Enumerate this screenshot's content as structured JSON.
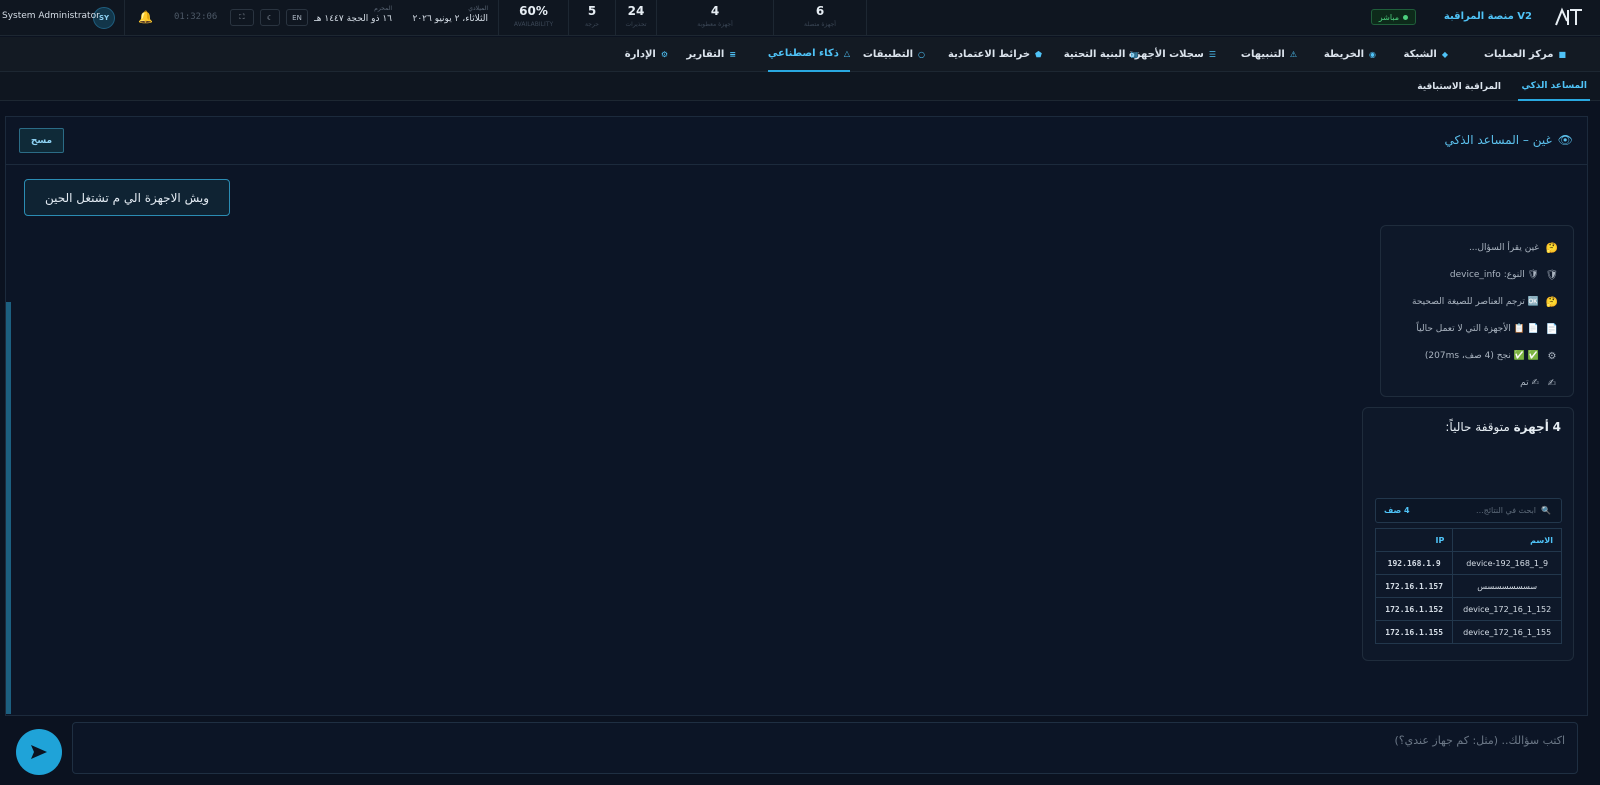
{
  "header": {
    "logo_text": "AM",
    "brand_title": "V2 منصة المراقبة",
    "live_label": "مباشر",
    "stats": [
      {
        "value": "60%",
        "label": "AVAILABILITY"
      },
      {
        "value": "24",
        "label": "تحذيرات"
      },
      {
        "value": "5",
        "label": "حرجة"
      },
      {
        "value": "4",
        "label": "أجهزة معطوبة"
      },
      {
        "value": "6",
        "label": "أجهزة متصلة"
      }
    ],
    "gregorian_label": "الميلادي",
    "gregorian_date": "الثلاثاء، ٢ يونيو ٢٠٢٦",
    "hijri_label": "المحرم",
    "hijri_date": "١٦ ذو الحجة ١٤٤٧ هـ",
    "lang_toggle": "EN",
    "clock": "01:32:06",
    "user_initials": "SY",
    "user_name": "System Administrator"
  },
  "nav": {
    "items": [
      {
        "label": "مركز العمليات",
        "icon": "■"
      },
      {
        "label": "الشبكة",
        "icon": "◆"
      },
      {
        "label": "الخريطة",
        "icon": "◉"
      },
      {
        "label": "التنبيهات",
        "icon": "⚠"
      },
      {
        "label": "سجلات الأجهزة",
        "icon": "☰"
      },
      {
        "label": "البنية التحتية",
        "icon": "▤"
      },
      {
        "label": "خرائط الاعتمادية",
        "icon": "⬟"
      },
      {
        "label": "التطبيقات",
        "icon": "○"
      },
      {
        "label": "ذكاء اصطناعي",
        "icon": "△"
      },
      {
        "label": "التقارير",
        "icon": "≡"
      },
      {
        "label": "الإدارة",
        "icon": "⚙"
      }
    ],
    "active_index": 8
  },
  "subtabs": {
    "items": [
      "المساعد الذكي",
      "المراقبة الاستباقية"
    ],
    "active_index": 0
  },
  "assistant": {
    "title": "غين – المساعد الذكي",
    "clear_label": "مسح",
    "user_message": "ويش الاجهزة الي م تشتغل الحين",
    "steps": [
      {
        "icon": "🤔",
        "text": "غين يقرأ السؤال..."
      },
      {
        "icon": "🛡",
        "text": "🛡 النوع: device_info"
      },
      {
        "icon": "🤔",
        "text": "🆗 ترجم العناصر للصيغة الصحيحة"
      },
      {
        "icon": "📄",
        "text": "📄 📋 الأجهزة التي لا تعمل حالياً"
      },
      {
        "icon": "⚙",
        "text": "✅ ✅ نجح (4 صف، 207ms)"
      },
      {
        "icon": "✍",
        "text": "✍ تم"
      }
    ],
    "answer_count": "4",
    "answer_bold": "أجهزة",
    "answer_rest": "متوقفة حالياً:",
    "search_placeholder": "ابحث في النتائج...",
    "row_count": "4 صف",
    "table_headers": [
      "الاسم",
      "IP"
    ],
    "rows": [
      {
        "name": "device-192_168_1_9",
        "ip": "192.168.1.9"
      },
      {
        "name": "سسسسسسسس",
        "ip": "172.16.1.157"
      },
      {
        "name": "device_172_16_1_152",
        "ip": "172.16.1.152"
      },
      {
        "name": "device_172_16_1_155",
        "ip": "172.16.1.155"
      }
    ]
  },
  "composer": {
    "placeholder": "اكتب سؤالك.. (مثل: كم جهاز عندي؟)"
  },
  "colors": {
    "accent": "#4fc3f7",
    "background": "#0b1220",
    "live": "#4cd07d",
    "send_button": "#1fa3d8"
  }
}
